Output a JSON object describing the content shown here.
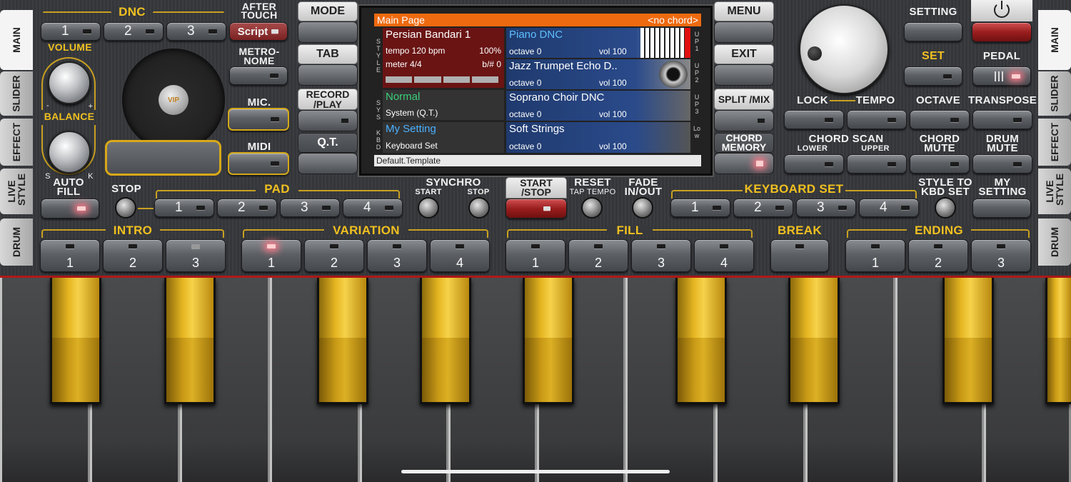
{
  "left_tabs": [
    "MAIN",
    "SLIDER",
    "EFFECT",
    "LIVE STYLE",
    "DRUM"
  ],
  "right_tabs": [
    "MAIN",
    "SLIDER",
    "EFFECT",
    "LIVE STYLE",
    "DRUM"
  ],
  "dnc": {
    "label": "DNC",
    "buttons": [
      "1",
      "2",
      "3"
    ]
  },
  "after_touch": {
    "label": "AFTER TOUCH",
    "button": "Script"
  },
  "metronome": "METRO-NOME",
  "volume": {
    "label": "VOLUME",
    "minus": "-",
    "plus": "+"
  },
  "balance": {
    "label": "BALANCE",
    "s": "S",
    "k": "K"
  },
  "vip": "VIP",
  "mic": "MIC.",
  "midi": "MIDI",
  "auto_fill": "AUTO FILL",
  "center_left": [
    "MODE",
    "TAB",
    "RECORD /PLAY",
    "Q.T."
  ],
  "center_right": [
    "MENU",
    "EXIT",
    "SPLIT /MIX",
    "CHORD MEMORY"
  ],
  "screen": {
    "header": "Main Page",
    "chord": "<no chord>",
    "style_name": "Persian Bandari 1",
    "tempo": "tempo 120 bpm",
    "percent": "100%",
    "meter": "meter 4/4",
    "bsharp": "b/# 0",
    "sys_name": "Normal",
    "sys_sub": "System (Q.T.)",
    "kbd_name": "My Setting",
    "kbd_sub": "Keyboard Set",
    "voices": [
      {
        "name": "Piano DNC",
        "octave": "octave 0",
        "vol": "vol 100",
        "side": "UP1"
      },
      {
        "name": "Jazz Trumpet Echo D..",
        "octave": "octave 0",
        "vol": "vol 100",
        "side": "UP2"
      },
      {
        "name": "Soprano Choir DNC",
        "octave": "octave 0",
        "vol": "vol 100",
        "side": "UP3"
      },
      {
        "name": "Soft Strings",
        "octave": "octave 0",
        "vol": "vol 100",
        "side": "Low"
      }
    ],
    "side_style": "STYLE",
    "side_sys": "SYS",
    "side_kbd": "KBD",
    "footer": "Default.Template"
  },
  "setting": "SETTING",
  "set": "SET",
  "pedal": "PEDAL",
  "lock": "LOCK",
  "tempo": "TEMPO",
  "octave": "OCTAVE",
  "transpose": "TRANSPOSE",
  "chord_scan": "CHORD SCAN",
  "lower": "LOWER",
  "upper": "UPPER",
  "chord_mute": "CHORD MUTE",
  "drum_mute": "DRUM MUTE",
  "stop": "STOP",
  "pad": {
    "label": "PAD",
    "buttons": [
      "1",
      "2",
      "3",
      "4"
    ]
  },
  "synchro": "SYNCHRO",
  "synchro_start": "START",
  "synchro_stop": "STOP",
  "start_stop": "START /STOP",
  "reset": "RESET",
  "tap_tempo": "TAP TEMPO",
  "fade": "FADE IN/OUT",
  "keyboard_set": {
    "label": "KEYBOARD SET",
    "buttons": [
      "1",
      "2",
      "3",
      "4"
    ]
  },
  "style_to_kbd": "STYLE TO KBD SET",
  "my_setting": "MY SETTING",
  "intro": {
    "label": "INTRO",
    "buttons": [
      "1",
      "2",
      "3"
    ]
  },
  "variation": {
    "label": "VARIATION",
    "buttons": [
      "1",
      "2",
      "3",
      "4"
    ]
  },
  "fill": {
    "label": "FILL",
    "buttons": [
      "1",
      "2",
      "3",
      "4"
    ]
  },
  "break": "BREAK",
  "ending": {
    "label": "ENDING",
    "buttons": [
      "1",
      "2",
      "3"
    ]
  }
}
